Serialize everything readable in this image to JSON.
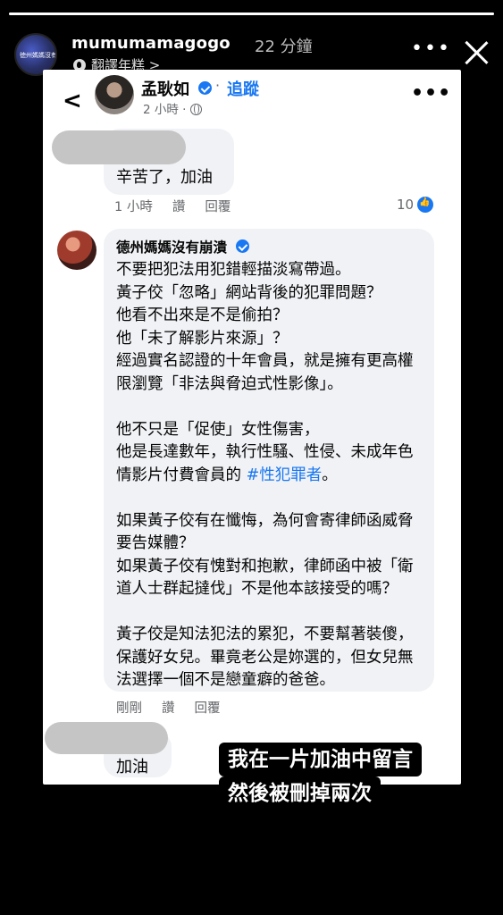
{
  "story": {
    "progress": 1.0,
    "username": "mumumamagogo",
    "avatar_text": "徳州媽媽沒有崩潰",
    "posted_ago": "22 分鐘",
    "music_label": "翻譯年糕 >",
    "menu_label": "•••",
    "caption_lines": [
      "我在一片加油中留言",
      "然後被刪掉兩次"
    ]
  },
  "post": {
    "back_label": "<",
    "author": "孟耿如",
    "dot": "·",
    "follow_label": "追蹤",
    "time": "2 小時 ·",
    "more_label": "•••"
  },
  "comments": [
    {
      "text": "辛苦了，加油",
      "time": "1 小時",
      "like_label": "讚",
      "reply_label": "回覆",
      "reaction_count": "10"
    },
    {
      "author": "德州媽媽沒有崩潰",
      "body_before_hashtag": "不要把犯法用犯錯輕描淡寫帶過。\n黃子佼「忽略」網站背後的犯罪問題？\n他看不出來是不是偷拍？\n他「未了解影片來源」？\n經過實名認證的十年會員，就是擁有更高權限瀏覽「非法與脅迫式性影像」。\n\n他不只是「促使」女性傷害，\n他是長達數年，執行性騷、性侵、未成年色情影片付費會員的 ",
      "hashtag": "#性犯罪者",
      "body_after_hashtag": "。\n\n如果黃子佼有在懺悔，為何會寄律師函威脅要告媒體？\n如果黃子佼有愧對和抱歉，律師函中被「衛道人士群起撻伐」不是他本該接受的嗎？\n\n黃子佼是知法犯法的累犯，不要幫著裝傻，保護好女兒。畢竟老公是妳選的，但女兒無法選擇一個不是戀童癖的爸爸。",
      "time": "剛剛",
      "like_label": "讚",
      "reply_label": "回覆"
    },
    {
      "text": "加油"
    }
  ],
  "colors": {
    "facebook_blue": "#1877f2",
    "bubble_gray": "#f0f2f5",
    "meta_gray": "#65676b"
  }
}
